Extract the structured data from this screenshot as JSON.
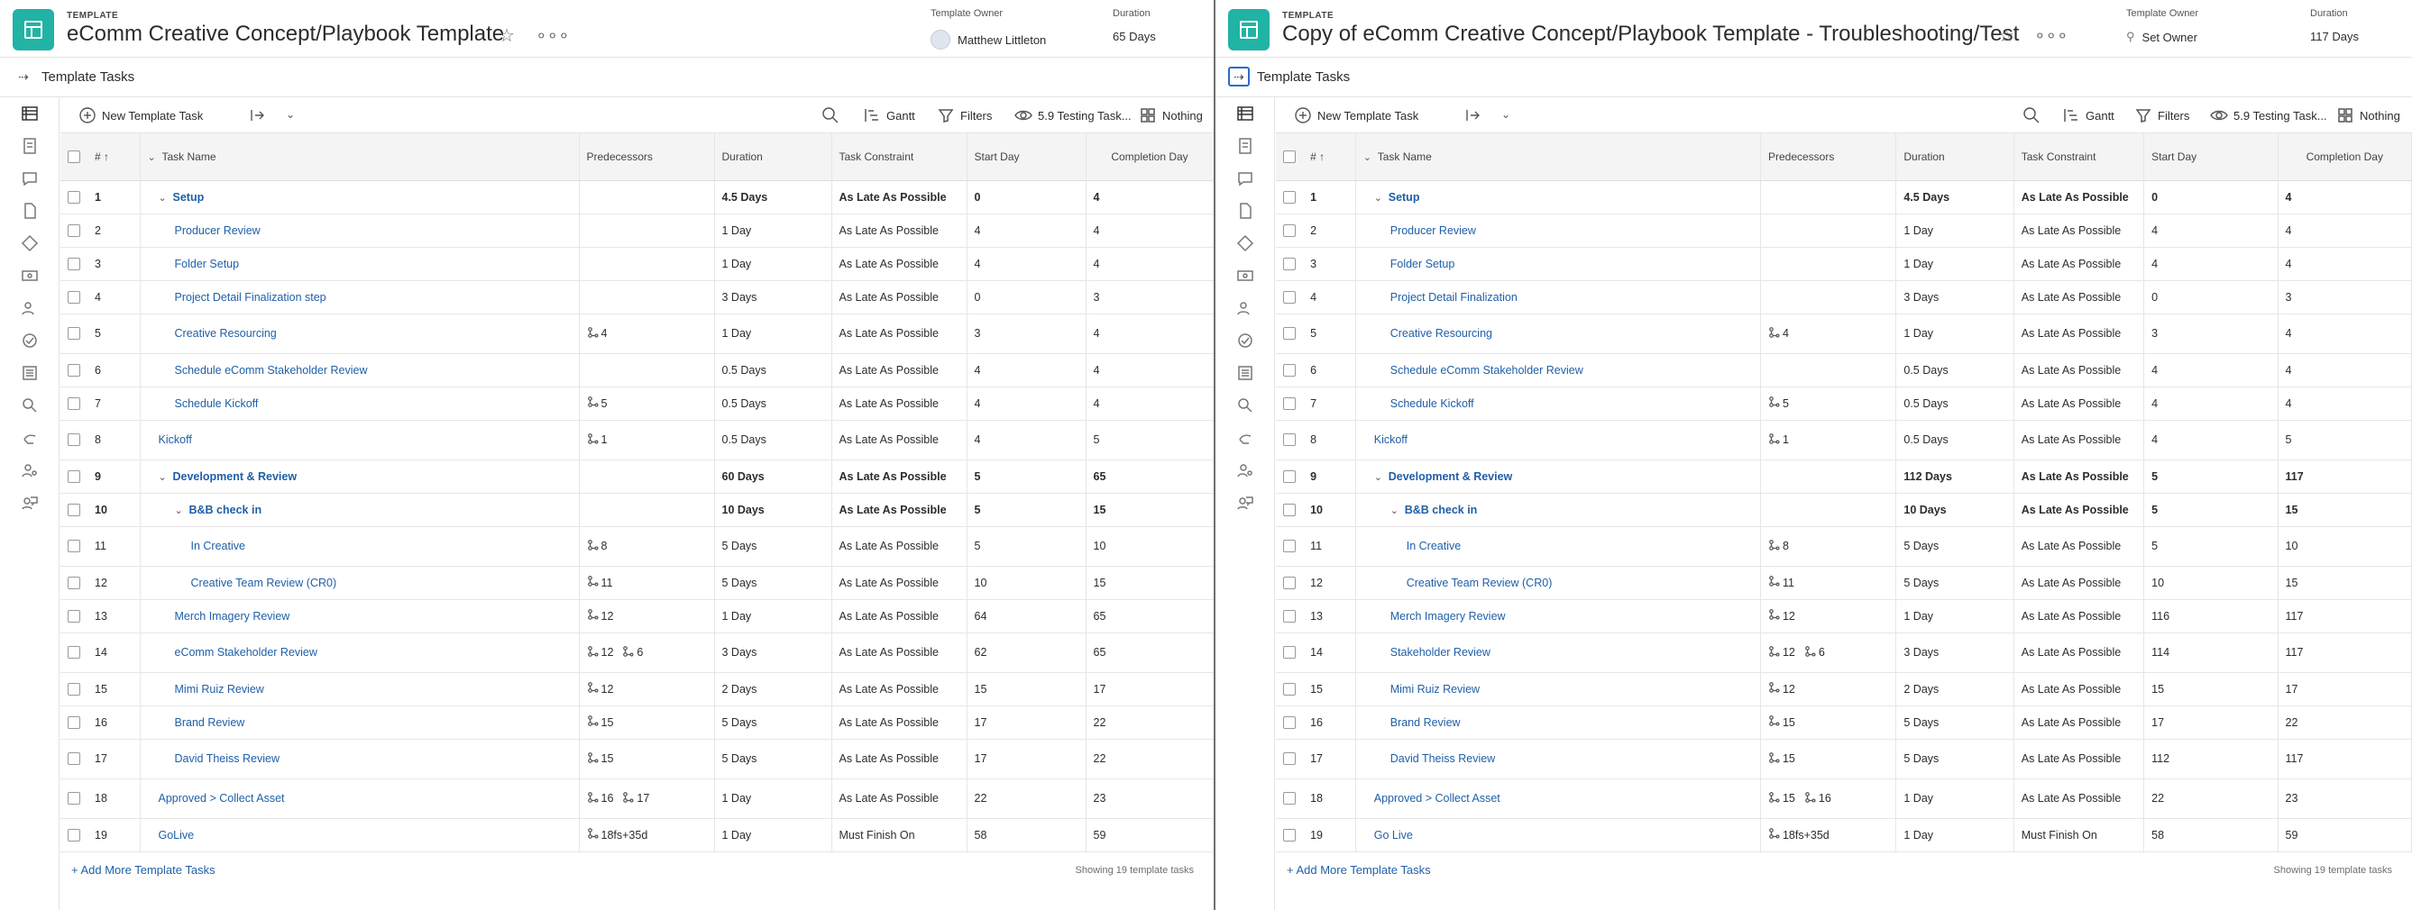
{
  "left": {
    "header": {
      "label": "TEMPLATE",
      "title": "eComm Creative Concept/Playbook Template",
      "owner_label": "Template Owner",
      "owner": "Matthew Littleton",
      "duration_label": "Duration",
      "duration": "65 Days"
    },
    "section_title": "Template Tasks",
    "toolbar": {
      "new_task": "New Template Task",
      "gantt": "Gantt",
      "filters": "Filters",
      "view": "5.9 Testing Task...",
      "grouping": "Nothing"
    },
    "columns": {
      "num": "#",
      "name": "Task Name",
      "pred": "Predecessors",
      "dur": "Duration",
      "constraint": "Task Constraint",
      "start": "Start Day",
      "completion": "Completion Day"
    },
    "rows": [
      {
        "num": "1",
        "name": "Setup",
        "pred": [],
        "dur": "4.5 Days",
        "con": "As Late As Possible",
        "start": "0",
        "comp": "4"
      },
      {
        "num": "2",
        "name": "Producer Review",
        "pred": [],
        "dur": "1 Day",
        "con": "As Late As Possible",
        "start": "4",
        "comp": "4"
      },
      {
        "num": "3",
        "name": "Folder Setup",
        "pred": [],
        "dur": "1 Day",
        "con": "As Late As Possible",
        "start": "4",
        "comp": "4"
      },
      {
        "num": "4",
        "name": "Project Detail Finalization step",
        "pred": [],
        "dur": "3 Days",
        "con": "As Late As Possible",
        "start": "0",
        "comp": "3"
      },
      {
        "num": "5",
        "name": "Creative Resourcing",
        "pred": [
          "4"
        ],
        "dur": "1 Day",
        "con": "As Late As Possible",
        "start": "3",
        "comp": "4"
      },
      {
        "num": "6",
        "name": "Schedule eComm Stakeholder Review",
        "pred": [],
        "dur": "0.5 Days",
        "con": "As Late As Possible",
        "start": "4",
        "comp": "4"
      },
      {
        "num": "7",
        "name": "Schedule Kickoff",
        "pred": [
          "5"
        ],
        "dur": "0.5 Days",
        "con": "As Late As Possible",
        "start": "4",
        "comp": "4"
      },
      {
        "num": "8",
        "name": "Kickoff",
        "pred": [
          "1"
        ],
        "dur": "0.5 Days",
        "con": "As Late As Possible",
        "start": "4",
        "comp": "5"
      },
      {
        "num": "9",
        "name": "Development & Review",
        "pred": [],
        "dur": "60 Days",
        "con": "As Late As Possible",
        "start": "5",
        "comp": "65"
      },
      {
        "num": "10",
        "name": "B&B check in",
        "pred": [],
        "dur": "10 Days",
        "con": "As Late As Possible",
        "start": "5",
        "comp": "15"
      },
      {
        "num": "11",
        "name": "In Creative",
        "pred": [
          "8"
        ],
        "dur": "5 Days",
        "con": "As Late As Possible",
        "start": "5",
        "comp": "10"
      },
      {
        "num": "12",
        "name": "Creative Team Review (CR0)",
        "pred": [
          "11"
        ],
        "dur": "5 Days",
        "con": "As Late As Possible",
        "start": "10",
        "comp": "15"
      },
      {
        "num": "13",
        "name": "Merch Imagery Review",
        "pred": [
          "12"
        ],
        "dur": "1 Day",
        "con": "As Late As Possible",
        "start": "64",
        "comp": "65"
      },
      {
        "num": "14",
        "name": "eComm Stakeholder Review",
        "pred": [
          "12",
          "6"
        ],
        "dur": "3 Days",
        "con": "As Late As Possible",
        "start": "62",
        "comp": "65"
      },
      {
        "num": "15",
        "name": "Mimi Ruiz Review",
        "pred": [
          "12"
        ],
        "dur": "2 Days",
        "con": "As Late As Possible",
        "start": "15",
        "comp": "17"
      },
      {
        "num": "16",
        "name": "Brand Review",
        "pred": [
          "15"
        ],
        "dur": "5 Days",
        "con": "As Late As Possible",
        "start": "17",
        "comp": "22"
      },
      {
        "num": "17",
        "name": "David Theiss Review",
        "pred": [
          "15"
        ],
        "dur": "5 Days",
        "con": "As Late As Possible",
        "start": "17",
        "comp": "22"
      },
      {
        "num": "18",
        "name": "Approved > Collect Asset",
        "pred": [
          "16",
          "17"
        ],
        "dur": "1 Day",
        "con": "As Late As Possible",
        "start": "22",
        "comp": "23"
      },
      {
        "num": "19",
        "name": "GoLive",
        "pred": [
          "18fs+35d"
        ],
        "dur": "1 Day",
        "con": "Must Finish On",
        "start": "58",
        "comp": "59"
      }
    ],
    "footer": {
      "add": "+ Add More Template Tasks",
      "showing": "Showing 19 template tasks"
    }
  },
  "right": {
    "header": {
      "label": "TEMPLATE",
      "title": "Copy of eComm Creative Concept/Playbook Template - Troubleshooting/Test",
      "owner_label": "Template Owner",
      "owner": "Set Owner",
      "duration_label": "Duration",
      "duration": "117 Days"
    },
    "section_title": "Template Tasks",
    "toolbar": {
      "new_task": "New Template Task",
      "gantt": "Gantt",
      "filters": "Filters",
      "view": "5.9 Testing Task...",
      "grouping": "Nothing"
    },
    "columns": {
      "num": "#",
      "name": "Task Name",
      "pred": "Predecessors",
      "dur": "Duration",
      "constraint": "Task Constraint",
      "start": "Start Day",
      "completion": "Completion Day"
    },
    "rows": [
      {
        "num": "1",
        "name": "Setup",
        "pred": [],
        "dur": "4.5 Days",
        "con": "As Late As Possible",
        "start": "0",
        "comp": "4"
      },
      {
        "num": "2",
        "name": "Producer Review",
        "pred": [],
        "dur": "1 Day",
        "con": "As Late As Possible",
        "start": "4",
        "comp": "4"
      },
      {
        "num": "3",
        "name": "Folder Setup",
        "pred": [],
        "dur": "1 Day",
        "con": "As Late As Possible",
        "start": "4",
        "comp": "4"
      },
      {
        "num": "4",
        "name": "Project Detail Finalization",
        "pred": [],
        "dur": "3 Days",
        "con": "As Late As Possible",
        "start": "0",
        "comp": "3"
      },
      {
        "num": "5",
        "name": "Creative Resourcing",
        "pred": [
          "4"
        ],
        "dur": "1 Day",
        "con": "As Late As Possible",
        "start": "3",
        "comp": "4"
      },
      {
        "num": "6",
        "name": "Schedule eComm Stakeholder Review",
        "pred": [],
        "dur": "0.5 Days",
        "con": "As Late As Possible",
        "start": "4",
        "comp": "4"
      },
      {
        "num": "7",
        "name": "Schedule Kickoff",
        "pred": [
          "5"
        ],
        "dur": "0.5 Days",
        "con": "As Late As Possible",
        "start": "4",
        "comp": "4"
      },
      {
        "num": "8",
        "name": "Kickoff",
        "pred": [
          "1"
        ],
        "dur": "0.5 Days",
        "con": "As Late As Possible",
        "start": "4",
        "comp": "5"
      },
      {
        "num": "9",
        "name": "Development & Review",
        "pred": [],
        "dur": "112 Days",
        "con": "As Late As Possible",
        "start": "5",
        "comp": "117"
      },
      {
        "num": "10",
        "name": "B&B check in",
        "pred": [],
        "dur": "10 Days",
        "con": "As Late As Possible",
        "start": "5",
        "comp": "15"
      },
      {
        "num": "11",
        "name": "In Creative",
        "pred": [
          "8"
        ],
        "dur": "5 Days",
        "con": "As Late As Possible",
        "start": "5",
        "comp": "10"
      },
      {
        "num": "12",
        "name": "Creative Team Review (CR0)",
        "pred": [
          "11"
        ],
        "dur": "5 Days",
        "con": "As Late As Possible",
        "start": "10",
        "comp": "15"
      },
      {
        "num": "13",
        "name": "Merch Imagery Review",
        "pred": [
          "12"
        ],
        "dur": "1 Day",
        "con": "As Late As Possible",
        "start": "116",
        "comp": "117"
      },
      {
        "num": "14",
        "name": "Stakeholder Review",
        "pred": [
          "12",
          "6"
        ],
        "dur": "3 Days",
        "con": "As Late As Possible",
        "start": "114",
        "comp": "117"
      },
      {
        "num": "15",
        "name": "Mimi Ruiz Review",
        "pred": [
          "12"
        ],
        "dur": "2 Days",
        "con": "As Late As Possible",
        "start": "15",
        "comp": "17"
      },
      {
        "num": "16",
        "name": "Brand Review",
        "pred": [
          "15"
        ],
        "dur": "5 Days",
        "con": "As Late As Possible",
        "start": "17",
        "comp": "22"
      },
      {
        "num": "17",
        "name": "David Theiss Review",
        "pred": [
          "15"
        ],
        "dur": "5 Days",
        "con": "As Late As Possible",
        "start": "112",
        "comp": "117"
      },
      {
        "num": "18",
        "name": "Approved > Collect Asset",
        "pred": [
          "15",
          "16"
        ],
        "dur": "1 Day",
        "con": "As Late As Possible",
        "start": "22",
        "comp": "23"
      },
      {
        "num": "19",
        "name": "Go Live",
        "pred": [
          "18fs+35d"
        ],
        "dur": "1 Day",
        "con": "Must Finish On",
        "start": "58",
        "comp": "59"
      }
    ],
    "footer": {
      "add": "+ Add More Template Tasks",
      "showing": "Showing 19 template tasks"
    }
  },
  "colors": {
    "accent": "#1f5fa8",
    "template_icon": "#21b3a4",
    "focus": "#2d6cc5"
  }
}
